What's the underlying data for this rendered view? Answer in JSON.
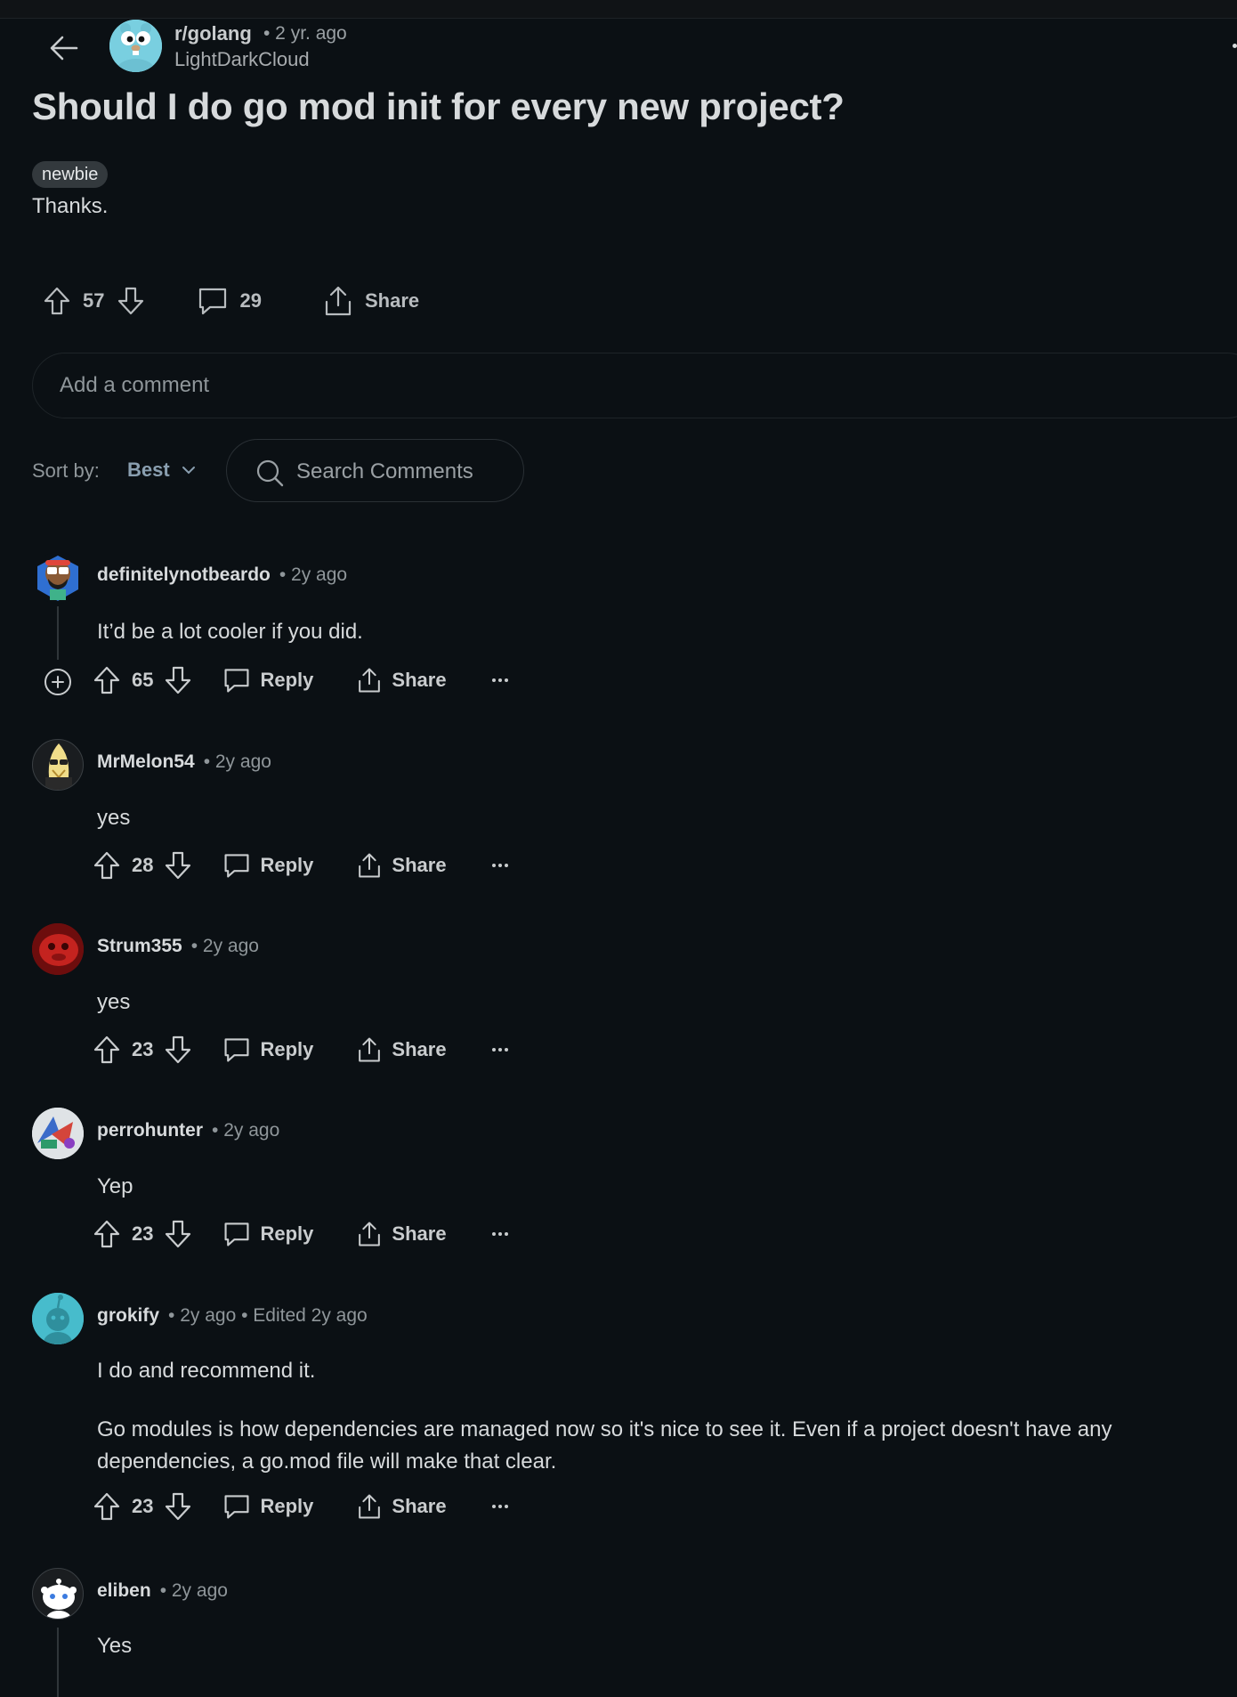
{
  "post": {
    "subreddit": "r/golang",
    "time": "• 2 yr. ago",
    "author": "LightDarkCloud",
    "title": "Should I do go mod init for every new project?",
    "flair": "newbie",
    "body": "Thanks.",
    "votes": "57",
    "comments": "29",
    "share_label": "Share"
  },
  "add_comment": {
    "placeholder": "Add a comment"
  },
  "sort": {
    "label": "Sort by:",
    "value": "Best"
  },
  "search_comments": {
    "placeholder": "Search Comments"
  },
  "comment_actions": {
    "reply": "Reply",
    "share": "Share"
  },
  "comments": [
    {
      "user": "definitelynotbeardo",
      "meta": "• 2y ago",
      "body": [
        "It’d be a lot cooler if you did."
      ],
      "votes": "65"
    },
    {
      "user": "MrMelon54",
      "meta": "• 2y ago",
      "body": [
        "yes"
      ],
      "votes": "28"
    },
    {
      "user": "Strum355",
      "meta": "• 2y ago",
      "body": [
        "yes"
      ],
      "votes": "23"
    },
    {
      "user": "perrohunter",
      "meta": "• 2y ago",
      "body": [
        "Yep"
      ],
      "votes": "23"
    },
    {
      "user": "grokify",
      "meta": "• 2y ago • Edited 2y ago",
      "body": [
        "I do and recommend it.",
        "Go modules is how dependencies are managed now so it's nice to see it. Even if a project doesn't have any dependencies, a go.mod file will make that clear."
      ],
      "votes": "23"
    },
    {
      "user": "eliben",
      "meta": "• 2y ago",
      "body": [
        "Yes"
      ]
    }
  ],
  "colors": {
    "background": "#0b1014",
    "text": "#d7dadc",
    "muted": "#8f969a",
    "sort_accent": "#8a9fb0"
  },
  "icons": [
    "back-arrow-icon",
    "upvote-icon",
    "downvote-icon",
    "comment-icon",
    "share-icon",
    "search-icon",
    "chevron-down-icon",
    "expand-thread-icon",
    "more-options-icon"
  ]
}
